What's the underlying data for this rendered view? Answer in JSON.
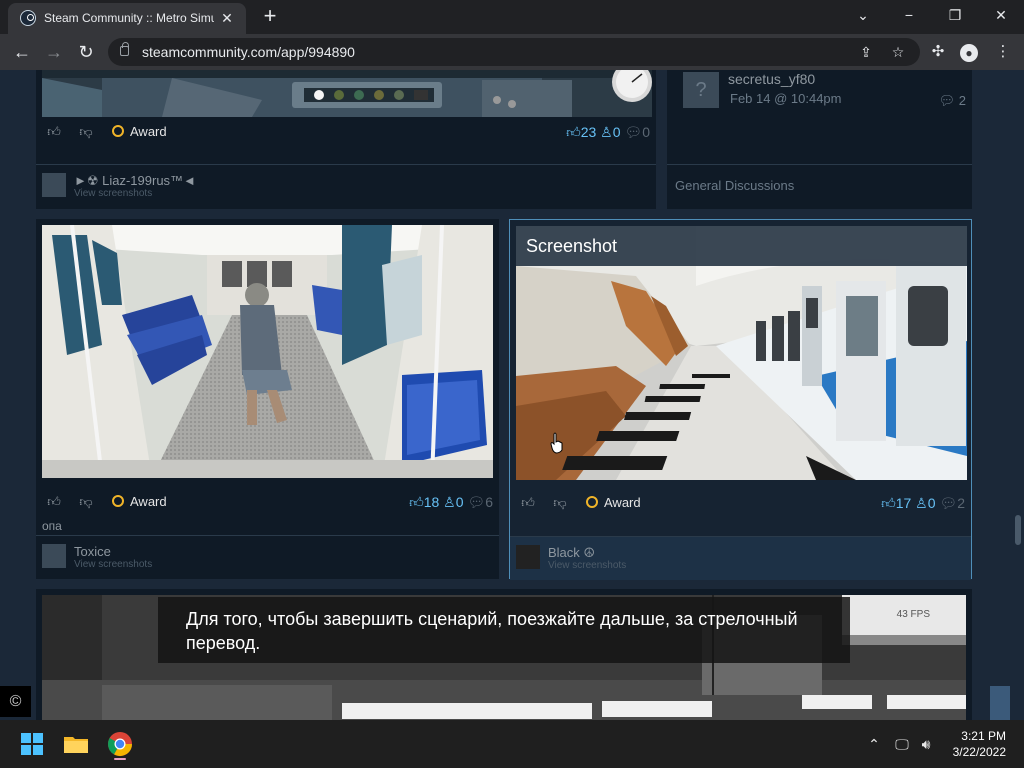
{
  "browser": {
    "tab_title": "Steam Community :: Metro Simul",
    "url": "steamcommunity.com/app/994890",
    "tab_close": "✕",
    "new_tab": "+",
    "win_minimize": "−",
    "win_restore": "❐",
    "win_close": "✕",
    "chevron": "⌄"
  },
  "cards": {
    "top_left": {
      "upvotes": "23",
      "awards": "0",
      "comments": "0",
      "award_label": "Award",
      "author": "►☢ Liaz-199rus™◄",
      "view": "View screenshots"
    },
    "top_right": {
      "author": "secretus_yf80",
      "date": "Feb 14 @ 10:44pm",
      "replies": "2",
      "forum": "General Discussions",
      "avatar_glyph": "?"
    },
    "mid_left": {
      "upvotes": "18",
      "awards": "0",
      "comments": "6",
      "award_label": "Award",
      "caption": "опа",
      "author": "Toxice",
      "view": "View screenshots"
    },
    "mid_right": {
      "overlay_title": "Screenshot",
      "upvotes": "17",
      "awards": "0",
      "comments": "2",
      "award_label": "Award",
      "author": "Black ☮",
      "view": "View screenshots"
    },
    "bottom": {
      "subtitle": "Для того, чтобы завершить сценарий, поезжайте дальше, за стрелочный перевод.",
      "fps": "43 FPS"
    }
  },
  "copyright_glyph": "©",
  "taskbar": {
    "time": "3:21 PM",
    "date": "3/22/2022"
  },
  "colors": {
    "steam_bg": "#1b2838",
    "accent_blue": "#67c1f5",
    "award_gold": "#f0b429"
  }
}
